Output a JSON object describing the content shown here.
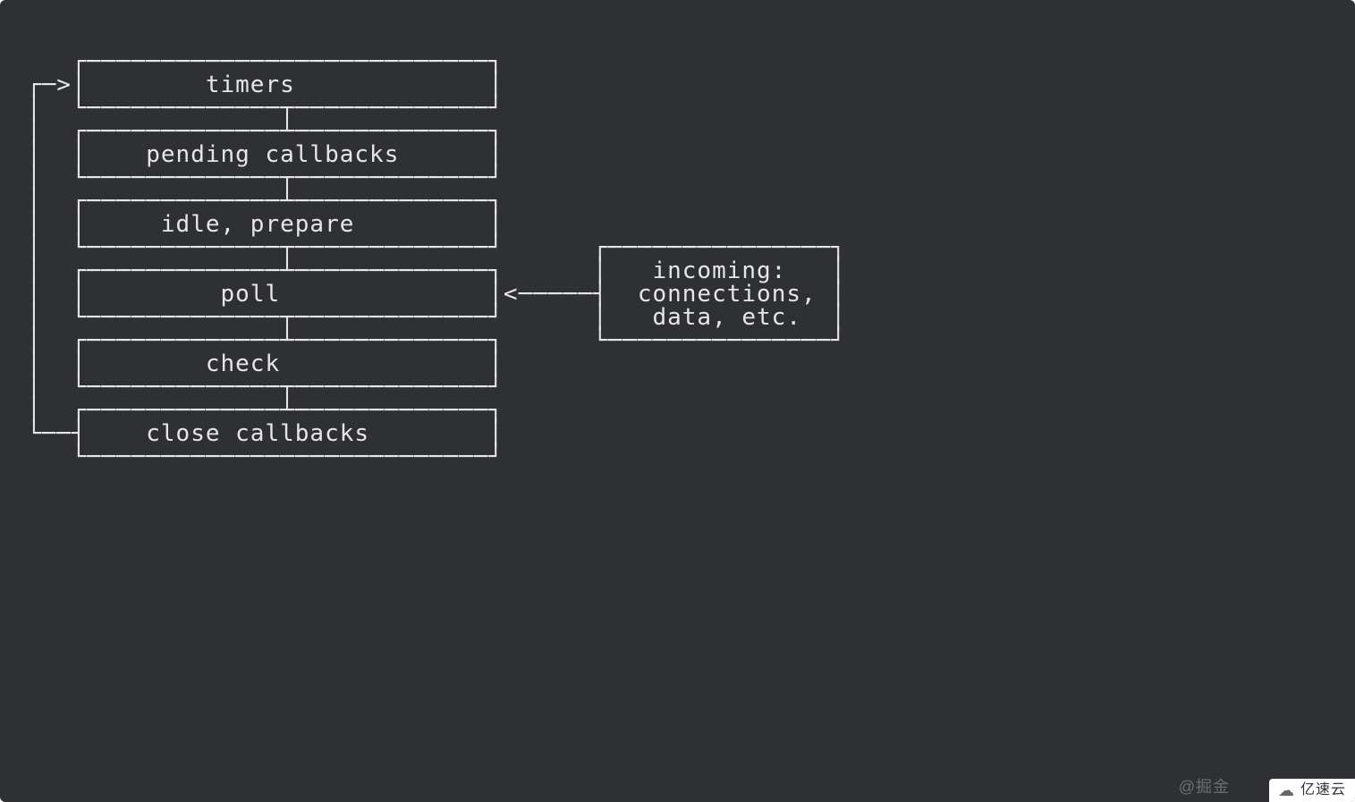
{
  "diagram": {
    "phases": [
      "timers",
      "pending callbacks",
      "idle, prepare",
      "poll",
      "check",
      "close callbacks"
    ],
    "incoming_box": {
      "line1": "incoming:",
      "line2": "connections,",
      "line3": "data, etc."
    }
  },
  "watermark_left": "@掘金",
  "watermark_right": "亿速云"
}
